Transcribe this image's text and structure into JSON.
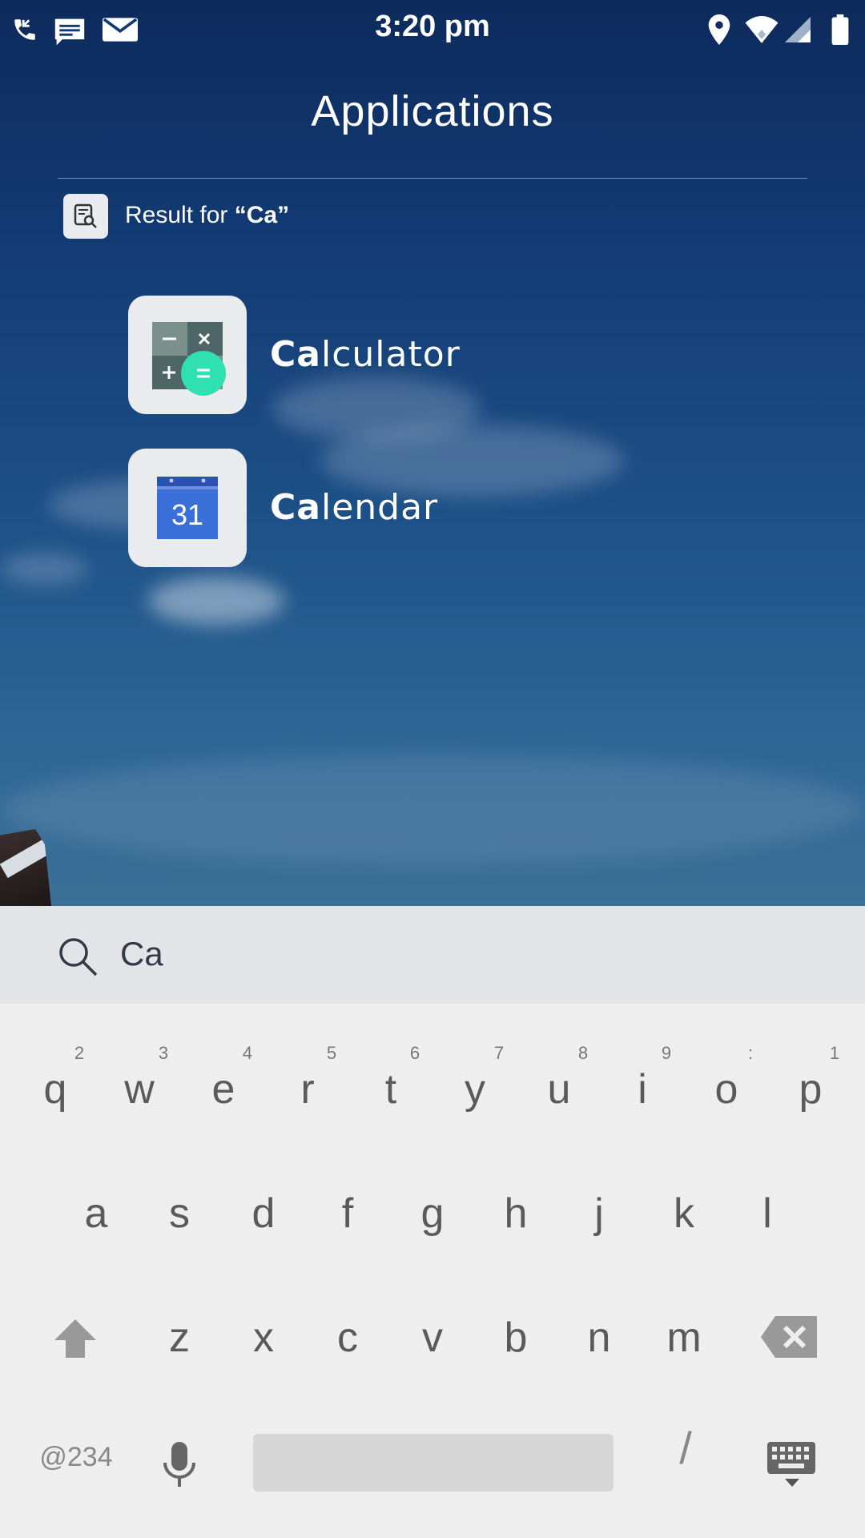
{
  "status_bar": {
    "time": "3:20 pm",
    "left_icons": [
      "phone-call-icon",
      "message-icon",
      "email-icon"
    ],
    "right_icons": [
      "location-icon",
      "wifi-icon",
      "signal-icon",
      "battery-icon"
    ]
  },
  "header": {
    "title": "Applications"
  },
  "search_result": {
    "prefix": "Result for ",
    "query_quoted": "“Ca”"
  },
  "apps": [
    {
      "highlight": "Ca",
      "rest": "lculator",
      "icon": "calculator-icon"
    },
    {
      "highlight": "Ca",
      "rest": "lendar",
      "icon": "calendar-icon",
      "calendar_day": "31"
    }
  ],
  "search": {
    "value": "Ca",
    "icon": "search-icon"
  },
  "keyboard": {
    "row1": [
      "q",
      "w",
      "e",
      "r",
      "t",
      "y",
      "u",
      "i",
      "o",
      "p"
    ],
    "row1_hints": [
      "2",
      "3",
      "4",
      "5",
      "6",
      "7",
      "8",
      "9",
      ":",
      "1"
    ],
    "row2": [
      "a",
      "s",
      "d",
      "f",
      "g",
      "h",
      "j",
      "k",
      "l"
    ],
    "row3": [
      "z",
      "x",
      "c",
      "v",
      "b",
      "n",
      "m"
    ],
    "symbols_label": "@234",
    "slash_label": "/"
  },
  "colors": {
    "accent_green": "#2fe0b0",
    "calendar_blue": "#3b6fd8",
    "keyboard_bg": "#eeeeee",
    "search_bar_bg": "#e2e4e7"
  }
}
